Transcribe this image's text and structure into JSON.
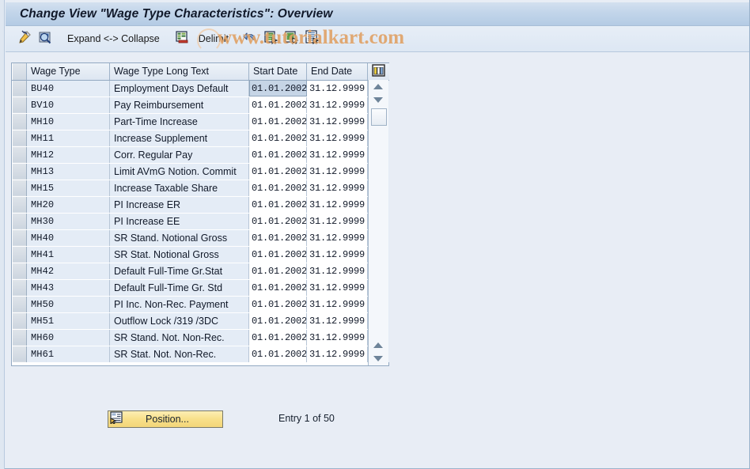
{
  "window": {
    "title": "Change View \"Wage Type Characteristics\": Overview"
  },
  "watermark": {
    "text": "www.tutorialkart.com"
  },
  "toolbar": {
    "items": [
      {
        "icon": "pencil-edit-icon",
        "label": ""
      },
      {
        "icon": "magnifier-display-icon",
        "label": ""
      },
      {
        "icon": "",
        "label": "Expand <-> Collapse"
      },
      {
        "icon": "delimit-table-icon",
        "label": ""
      },
      {
        "icon": "",
        "label": "Delimit"
      },
      {
        "icon": "undo-arrow-icon",
        "label": ""
      },
      {
        "icon": "copy-entry-icon",
        "label": ""
      },
      {
        "icon": "new-entry-icon",
        "label": ""
      },
      {
        "icon": "details-list-icon",
        "label": ""
      }
    ],
    "expand_collapse_label": "Expand <-> Collapse",
    "delimit_label": "Delimit"
  },
  "table": {
    "columns": [
      "Wage Type",
      "Wage Type Long Text",
      "Start Date",
      "End Date"
    ],
    "column_config_icon": "column-config-icon",
    "selected_cell": {
      "row": 0,
      "column": "Start Date"
    },
    "rows": [
      {
        "wage_type": "BU40",
        "long_text": "Employment Days Default",
        "start_date": "01.01.2002",
        "end_date": "31.12.9999"
      },
      {
        "wage_type": "BV10",
        "long_text": "Pay Reimbursement",
        "start_date": "01.01.2002",
        "end_date": "31.12.9999"
      },
      {
        "wage_type": "MH10",
        "long_text": "Part-Time Increase",
        "start_date": "01.01.2002",
        "end_date": "31.12.9999"
      },
      {
        "wage_type": "MH11",
        "long_text": "Increase Supplement",
        "start_date": "01.01.2002",
        "end_date": "31.12.9999"
      },
      {
        "wage_type": "MH12",
        "long_text": "Corr. Regular Pay",
        "start_date": "01.01.2002",
        "end_date": "31.12.9999"
      },
      {
        "wage_type": "MH13",
        "long_text": "Limit AVmG Notion. Commit",
        "start_date": "01.01.2002",
        "end_date": "31.12.9999"
      },
      {
        "wage_type": "MH15",
        "long_text": "Increase Taxable Share",
        "start_date": "01.01.2002",
        "end_date": "31.12.9999"
      },
      {
        "wage_type": "MH20",
        "long_text": "PI Increase ER",
        "start_date": "01.01.2002",
        "end_date": "31.12.9999"
      },
      {
        "wage_type": "MH30",
        "long_text": "PI Increase EE",
        "start_date": "01.01.2002",
        "end_date": "31.12.9999"
      },
      {
        "wage_type": "MH40",
        "long_text": "SR Stand. Notional Gross",
        "start_date": "01.01.2002",
        "end_date": "31.12.9999"
      },
      {
        "wage_type": "MH41",
        "long_text": "SR Stat. Notional Gross",
        "start_date": "01.01.2002",
        "end_date": "31.12.9999"
      },
      {
        "wage_type": "MH42",
        "long_text": "Default Full-Time Gr.Stat",
        "start_date": "01.01.2002",
        "end_date": "31.12.9999"
      },
      {
        "wage_type": "MH43",
        "long_text": "Default Full-Time Gr. Std",
        "start_date": "01.01.2002",
        "end_date": "31.12.9999"
      },
      {
        "wage_type": "MH50",
        "long_text": "PI Inc. Non-Rec. Payment",
        "start_date": "01.01.2002",
        "end_date": "31.12.9999"
      },
      {
        "wage_type": "MH51",
        "long_text": "Outflow Lock /319 /3DC",
        "start_date": "01.01.2002",
        "end_date": "31.12.9999"
      },
      {
        "wage_type": "MH60",
        "long_text": "SR Stand. Not. Non-Rec.",
        "start_date": "01.01.2002",
        "end_date": "31.12.9999"
      },
      {
        "wage_type": "MH61",
        "long_text": "SR Stat. Not. Non-Rec.",
        "start_date": "01.01.2002",
        "end_date": "31.12.9999"
      }
    ]
  },
  "footer": {
    "position_button_label": "Position...",
    "position_button_icon": "position-icon",
    "entry_info": "Entry 1 of 50"
  },
  "colors": {
    "window_background": "#e8edf5",
    "title_bar": "#c2d5ea",
    "row_background": "#e4ecf6",
    "date_cell_background": "#ffffff",
    "selected_cell": "#c6d5e6",
    "watermark": "#e0a368",
    "position_button": "#f8e08a"
  }
}
